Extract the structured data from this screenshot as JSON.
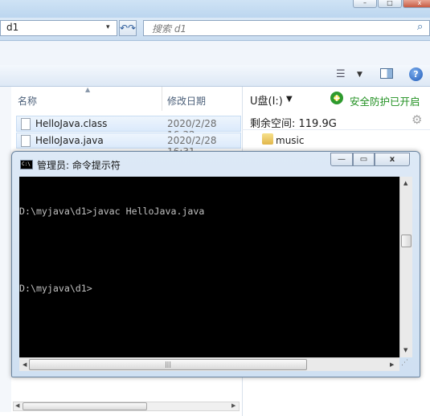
{
  "explorer": {
    "window_buttons": {
      "minimize": "–",
      "maximize": "□",
      "close": "x"
    },
    "address": {
      "path": "d1",
      "dropdown": "▾",
      "refresh": "↶↷"
    },
    "search": {
      "placeholder": "搜索 d1",
      "icon": "search-icon"
    },
    "toolbar": {
      "view_icon": "views-icon",
      "pane_icon": "preview-pane-icon",
      "help_icon": "?"
    },
    "columns": {
      "name": "名称",
      "modified": "修改日期"
    },
    "files": [
      {
        "name": "HelloJava.class",
        "modified": "2020/2/28 16:32",
        "selected": true
      },
      {
        "name": "HelloJava.java",
        "modified": "2020/2/28 16:31",
        "selected": true
      }
    ],
    "drive": {
      "label": "U盘(I:)",
      "protection": "安全防护已开启",
      "free_space": "剩余空间: 119.9G",
      "folders": [
        "music"
      ]
    }
  },
  "cmd": {
    "title": "管理员: 命令提示符",
    "icon_text": "C:\\",
    "buttons": {
      "minimize": "—",
      "maximize": "▭",
      "close": "x"
    },
    "lines": [
      "D:\\myjava\\d1>javac HelloJava.java",
      "",
      "D:\\myjava\\d1>"
    ],
    "hscroll_grip": "|||"
  },
  "colors": {
    "console_bg": "#000000",
    "console_text": "#c0c0c0",
    "safe_green": "#1f8f1f"
  }
}
